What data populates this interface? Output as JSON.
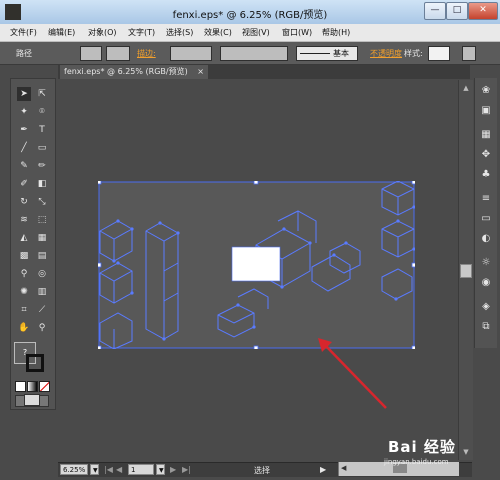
{
  "window": {
    "title": "fenxi.eps* @ 6.25% (RGB/预览)",
    "minimize_glyph": "—",
    "maximize_glyph": "□",
    "close_glyph": "✕"
  },
  "menu": {
    "items": [
      "文件(F)",
      "编辑(E)",
      "对象(O)",
      "文字(T)",
      "选择(S)",
      "效果(C)",
      "视图(V)",
      "窗口(W)",
      "帮助(H)"
    ]
  },
  "control_bar": {
    "object_type": "路径",
    "stroke_label": "描边:",
    "stroke_style_label": "基本",
    "opacity_label": "不透明度",
    "style_label": "样式:"
  },
  "document_tab": {
    "label": "fenxi.eps* @ 6.25% (RGB/预览)",
    "close_glyph": "×"
  },
  "status_bar": {
    "zoom": "6.25%",
    "page": "1",
    "tool": "选择"
  },
  "watermark": {
    "logo": "Bai 经验",
    "url": "jingyan.baidu.com"
  },
  "colors": {
    "selection": "#4a6cf0",
    "annotation_arrow": "#d7262d",
    "canvas": "#4a4a4a",
    "artboard": "#5a5a5a"
  }
}
